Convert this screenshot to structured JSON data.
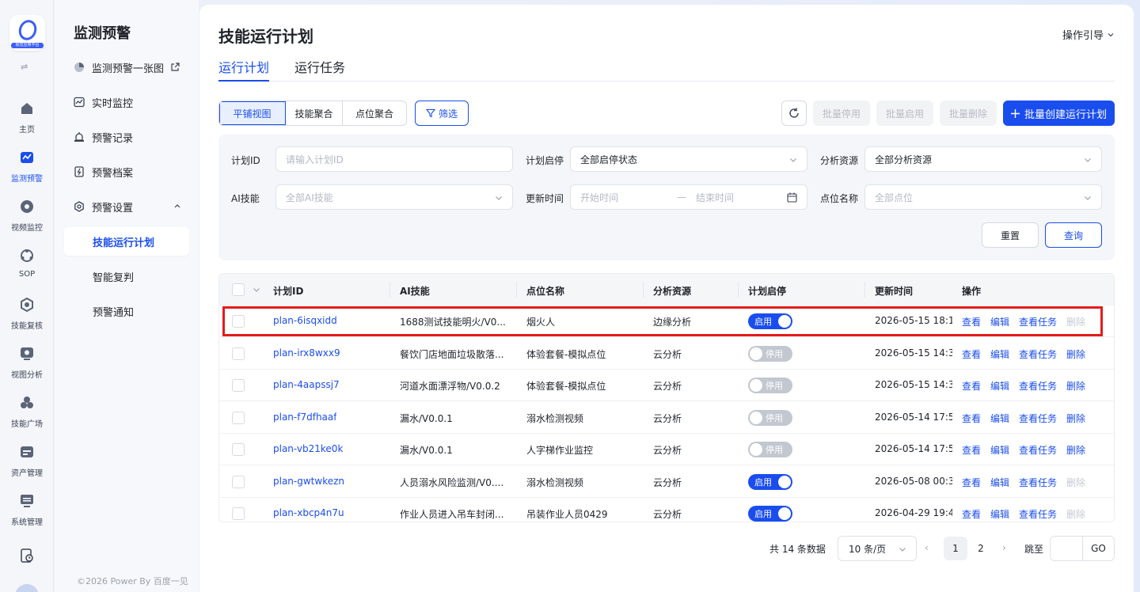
{
  "rail": {
    "logo_caption": "视觉应用平台",
    "items": [
      {
        "label": "主页",
        "icon": "home-icon"
      },
      {
        "label": "监测预警",
        "icon": "monitor-chart-icon"
      },
      {
        "label": "视频监控",
        "icon": "camera-icon"
      },
      {
        "label": "SOP",
        "icon": "sop-icon"
      },
      {
        "label": "技能复核",
        "icon": "skill-review-icon"
      },
      {
        "label": "视图分析",
        "icon": "view-analysis-icon"
      },
      {
        "label": "技能广场",
        "icon": "skill-square-icon"
      },
      {
        "label": "资产管理",
        "icon": "asset-icon"
      },
      {
        "label": "系统管理",
        "icon": "system-icon"
      }
    ]
  },
  "nav": {
    "title": "监测预警",
    "items": [
      {
        "label": "监测预警一张图",
        "icon": "pie-chart-icon"
      },
      {
        "label": "实时监控",
        "icon": "line-chart-icon"
      },
      {
        "label": "预警记录",
        "icon": "alarm-icon"
      },
      {
        "label": "预警档案",
        "icon": "file-icon"
      },
      {
        "label": "预警设置",
        "icon": "settings-icon"
      },
      {
        "label": "技能运行计划"
      },
      {
        "label": "智能复判"
      },
      {
        "label": "预警通知"
      }
    ],
    "footer": "©2026 Power By 百度一见"
  },
  "header": {
    "title": "技能运行计划",
    "guide": "操作引导"
  },
  "tabs": [
    "运行计划",
    "运行任务"
  ],
  "toolbar": {
    "views": [
      "平铺视图",
      "技能聚合",
      "点位聚合"
    ],
    "filter": "筛选",
    "batch_stop": "批量停用",
    "batch_start": "批量启用",
    "batch_delete": "批量删除",
    "create": "批量创建运行计划"
  },
  "filters": {
    "plan_id_label": "计划ID",
    "plan_id_placeholder": "请输入计划ID",
    "status_label": "计划启停",
    "status_value": "全部启停状态",
    "resource_label": "分析资源",
    "resource_value": "全部分析资源",
    "skill_label": "AI技能",
    "skill_placeholder": "全部AI技能",
    "time_label": "更新时间",
    "time_start": "开始时间",
    "time_sep": "—",
    "time_end": "结束时间",
    "point_label": "点位名称",
    "point_placeholder": "全部点位",
    "reset": "重置",
    "query": "查询"
  },
  "table": {
    "columns": [
      "计划ID",
      "AI技能",
      "点位名称",
      "分析资源",
      "计划启停",
      "更新时间",
      "操作"
    ],
    "actions": [
      "查看",
      "编辑",
      "查看任务",
      "删除"
    ],
    "rows": [
      {
        "id": "plan-6isqxidd",
        "skill": "1688测试技能明火/V0....",
        "point": "烟火人",
        "resource": "边缘分析",
        "status": "启用",
        "on": true,
        "time": "2026-05-15 18:1"
      },
      {
        "id": "plan-irx8wxx9",
        "skill": "餐饮门店地面垃圾散落...",
        "point": "体验套餐-模拟点位",
        "resource": "云分析",
        "status": "停用",
        "on": false,
        "time": "2026-05-15 14:3"
      },
      {
        "id": "plan-4aapssj7",
        "skill": "河道水面漂浮物/V0.0.2",
        "point": "体验套餐-模拟点位",
        "resource": "云分析",
        "status": "停用",
        "on": false,
        "time": "2026-05-15 14:3"
      },
      {
        "id": "plan-f7dfhaaf",
        "skill": "漏水/V0.0.1",
        "point": "溺水检测视频",
        "resource": "云分析",
        "status": "停用",
        "on": false,
        "time": "2026-05-14 17:5"
      },
      {
        "id": "plan-vb21ke0k",
        "skill": "漏水/V0.0.1",
        "point": "人字梯作业监控",
        "resource": "云分析",
        "status": "停用",
        "on": false,
        "time": "2026-05-14 17:5"
      },
      {
        "id": "plan-gwtwkezn",
        "skill": "人员溺水风险监测/V0....",
        "point": "溺水检测视频",
        "resource": "云分析",
        "status": "启用",
        "on": true,
        "time": "2026-05-08 00:3"
      },
      {
        "id": "plan-xbcp4n7u",
        "skill": "作业人员进入吊车封闭...",
        "point": "吊装作业人员0429",
        "resource": "云分析",
        "status": "启用",
        "on": true,
        "time": "2026-04-29 19:4"
      }
    ]
  },
  "pagination": {
    "total": "共 14 条数据",
    "page_size": "10 条/页",
    "pages": [
      "1",
      "2"
    ],
    "current": "1",
    "jump_label": "跳至",
    "go": "GO"
  },
  "colors": {
    "accent": "#1a4dee",
    "highlight": "#e31b1b"
  }
}
